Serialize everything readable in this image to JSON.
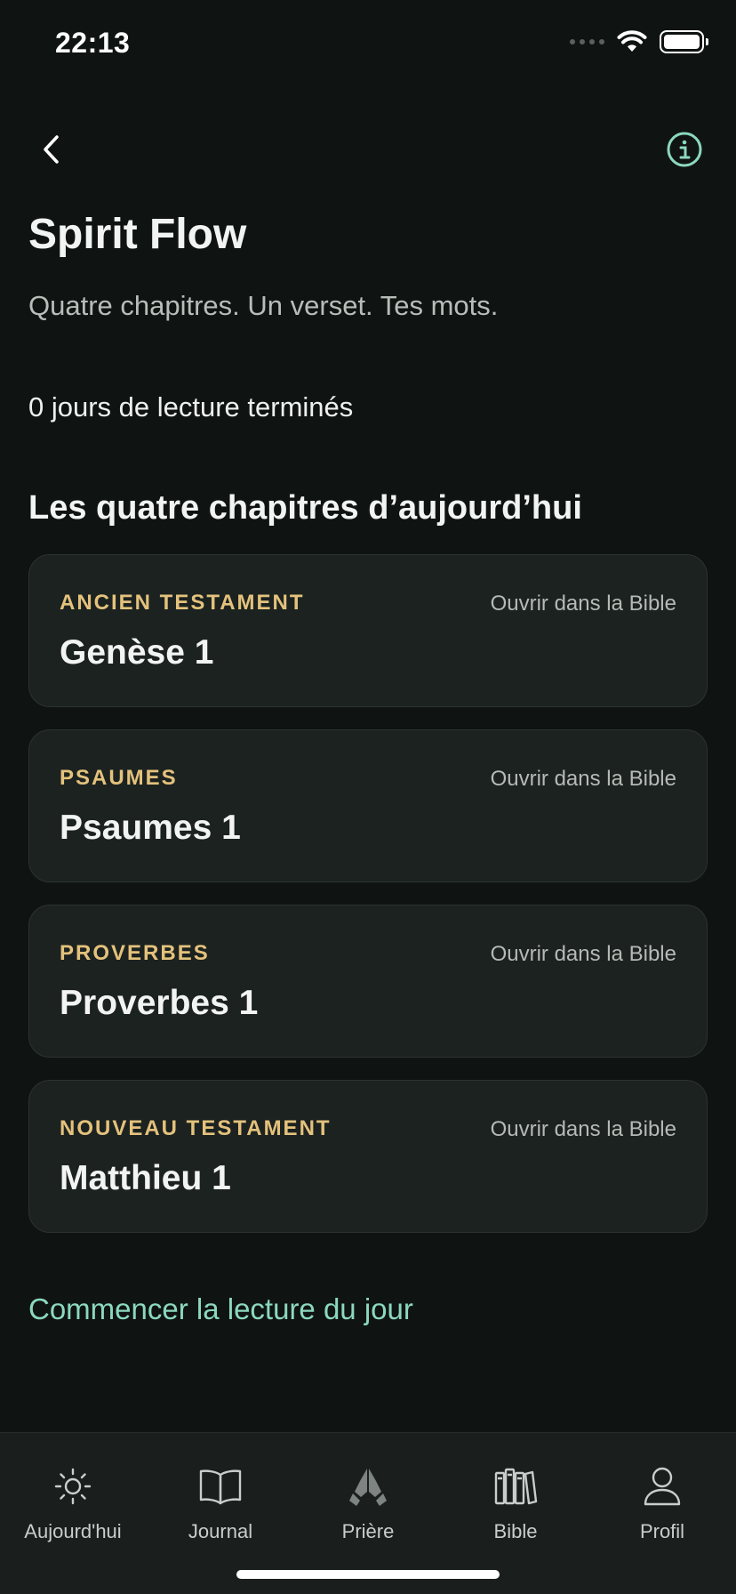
{
  "status_bar": {
    "time": "22:13"
  },
  "header": {
    "title": "Spirit Flow",
    "subtitle": "Quatre chapitres. Un verset. Tes mots.",
    "streak": "0 jours de lecture terminés",
    "section_title": "Les quatre chapitres d’aujourd’hui"
  },
  "cards": [
    {
      "category": "ANCIEN TESTAMENT",
      "title": "Genèse 1",
      "link": "Ouvrir dans la Bible"
    },
    {
      "category": "PSAUMES",
      "title": "Psaumes 1",
      "link": "Ouvrir dans la Bible"
    },
    {
      "category": "PROVERBES",
      "title": "Proverbes 1",
      "link": "Ouvrir dans la Bible"
    },
    {
      "category": "NOUVEAU TESTAMENT",
      "title": "Matthieu 1",
      "link": "Ouvrir dans la Bible"
    }
  ],
  "cta": {
    "label": "Commencer la lecture du jour"
  },
  "tabs": [
    {
      "label": "Aujourd'hui",
      "icon": "sun-icon"
    },
    {
      "label": "Journal",
      "icon": "book-open-icon"
    },
    {
      "label": "Prière",
      "icon": "praying-hands-icon"
    },
    {
      "label": "Bible",
      "icon": "books-icon"
    },
    {
      "label": "Profil",
      "icon": "person-icon"
    }
  ],
  "colors": {
    "background": "#0f1412",
    "card": "#1c2220",
    "category_gold": "#e4c27c",
    "accent_mint": "#8cd8bf"
  }
}
